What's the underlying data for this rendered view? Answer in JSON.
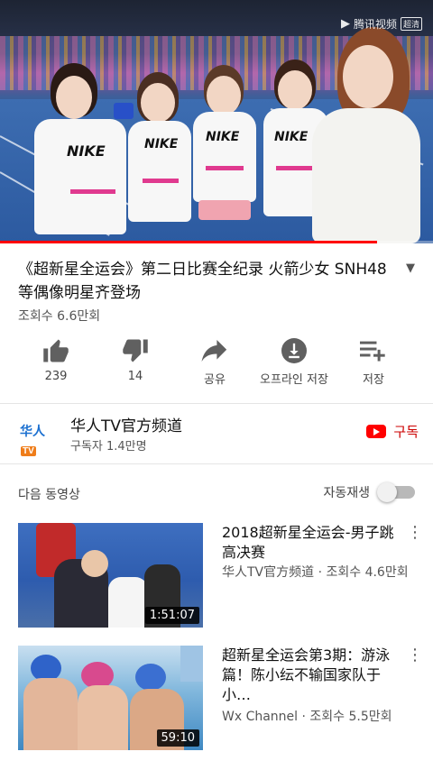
{
  "player": {
    "watermark": "腾讯视频",
    "watermark_badge": "超清",
    "shirt_logo": "NIKE",
    "progress_fraction": 0.87
  },
  "video": {
    "title": "《超新星全运会》第二日比赛全纪录 火箭少女 SNH48 等偶像明星齐登场",
    "views": "조회수 6.6만회"
  },
  "actions": [
    {
      "icon": "thumbs-up-icon",
      "label": "239"
    },
    {
      "icon": "thumbs-down-icon",
      "label": "14"
    },
    {
      "icon": "share-icon",
      "label": "공유"
    },
    {
      "icon": "download-icon",
      "label": "오프라인 저장"
    },
    {
      "icon": "playlist-add-icon",
      "label": "저장"
    }
  ],
  "channel": {
    "avatar_text": "华人",
    "avatar_badge": "TV",
    "name": "华人TV官方频道",
    "subscribers": "구독자 1.4만명",
    "subscribe_label": "구독"
  },
  "upnext": {
    "label": "다음 동영상",
    "autoplay_label": "자동재생",
    "autoplay_on": false
  },
  "recommendations": [
    {
      "title": "2018超新星全运会-男子跳高决赛",
      "meta": "华人TV官方频道 · 조회수 4.6만회",
      "duration": "1:51:07"
    },
    {
      "title": "超新星全运会第3期：游泳篇！陈小纭不输国家队于小…",
      "meta": "Wx Channel · 조회수 5.5만회",
      "duration": "59:10"
    }
  ],
  "colors": {
    "accent_red": "#ff0000",
    "subscribe_text": "#cc0000",
    "nike_stripe": "#e03a8f"
  }
}
